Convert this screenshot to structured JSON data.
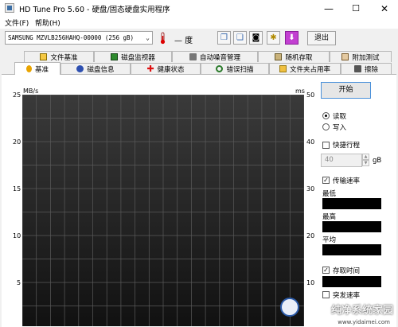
{
  "window": {
    "title": "HD Tune Pro 5.60 - 硬盘/固态硬盘实用程序",
    "minimize": "—",
    "maximize": "☐",
    "close": "✕"
  },
  "menu": {
    "items": [
      "文件(F)",
      "帮助(H)"
    ]
  },
  "toolbar": {
    "drive": "SAMSUNG MZVLB256HAHQ-00000 (256 gB)",
    "temperature": "— 度",
    "exit_label": "退出"
  },
  "tabs_top": [
    "文件基准",
    "磁盘监视器",
    "自动噪音管理",
    "随机存取",
    "附加测试"
  ],
  "tabs_bottom": [
    "基准",
    "磁盘信息",
    "健康状态",
    "错误扫描",
    "文件夹占用率",
    "擦除"
  ],
  "chart": {
    "y_left_unit": "MB/s",
    "y_right_unit": "ms",
    "y_left_ticks": [
      "25",
      "20",
      "15",
      "10",
      "5"
    ],
    "y_right_ticks": [
      "50",
      "40",
      "30",
      "20",
      "10"
    ]
  },
  "chart_data": {
    "type": "line",
    "ylabel": "MB/s",
    "ylim": [
      0,
      25
    ],
    "y2label": "ms",
    "y2lim": [
      0,
      50
    ],
    "series": [],
    "grid": true
  },
  "side": {
    "start_label": "开始",
    "read_label": "读取",
    "write_label": "写入",
    "short_stroke_label": "快捷行程",
    "short_stroke_value": "40",
    "short_stroke_unit": "gB",
    "transfer_rate_label": "传输速率",
    "min_label": "最低",
    "max_label": "最高",
    "avg_label": "平均",
    "access_time_label": "存取时间",
    "burst_label": "突发速率"
  },
  "watermark": {
    "text": "纯净系统家园",
    "url": "www.yidaimei.com"
  }
}
